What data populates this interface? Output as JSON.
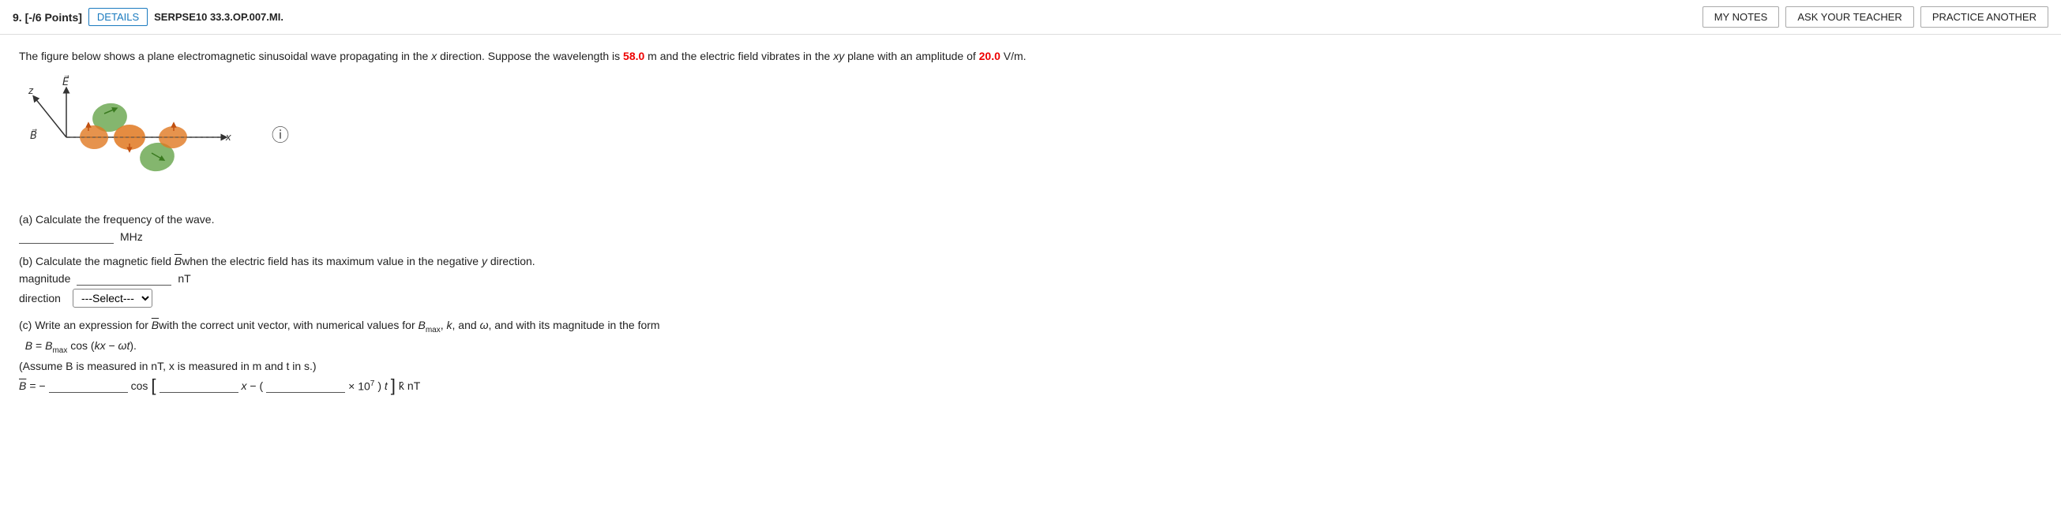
{
  "header": {
    "question_num": "9.",
    "points": "[-/6 Points]",
    "details_label": "DETAILS",
    "problem_id": "SERPSE10 33.3.OP.007.MI.",
    "my_notes_label": "MY NOTES",
    "ask_teacher_label": "ASK YOUR TEACHER",
    "practice_another_label": "PRACTICE ANOTHER"
  },
  "problem": {
    "description_part1": "The figure below shows a plane electromagnetic sinusoidal wave propagating in the ",
    "x_var": "x",
    "description_part2": " direction. Suppose the wavelength is ",
    "wavelength_value": "58.0",
    "wavelength_unit": " m and the electric field vibrates in the ",
    "xy_var": "xy",
    "description_part3": " plane with an amplitude of ",
    "amplitude_value": "20.0",
    "amplitude_unit": " V/m."
  },
  "parts": {
    "a": {
      "label": "(a) Calculate the frequency of the wave.",
      "input_placeholder": "",
      "unit": "MHz"
    },
    "b": {
      "label": "(b) Calculate the magnetic field ",
      "b_vector": "B",
      "label2": "when the electric field has its maximum value in the negative ",
      "y_var": "y",
      "label3": " direction.",
      "magnitude_label": "magnitude",
      "magnitude_unit": "nT",
      "direction_label": "direction",
      "select_placeholder": "---Select---"
    },
    "c": {
      "label": "(c) Write an expression for ",
      "b_vector": "B",
      "label2": "with the correct unit vector, with numerical values for ",
      "b_max": "B",
      "b_max_sub": "max",
      "label3": ", ",
      "k_var": "k",
      "label4": ", and ",
      "omega_var": "ω",
      "label5": ", and with its magnitude in the form",
      "formula": "B = B",
      "formula_sub": "max",
      "formula2": " cos (",
      "formula_kx": "kx",
      "formula_minus": " − ",
      "formula_omega": "ωt",
      "formula3": ").",
      "assume_text": "(Assume B is measured in nT, x is measured in m and t in s.)",
      "expression_b_label": "B = −",
      "expression_cos": "cos",
      "expression_x_minus": "x −",
      "expression_times": "×",
      "expression_power": "10",
      "expression_power_exp": "7",
      "expression_t_paren": ") t",
      "expression_k_hat": "k̂",
      "expression_nt": "nT"
    }
  },
  "info_icon": "ⓘ"
}
